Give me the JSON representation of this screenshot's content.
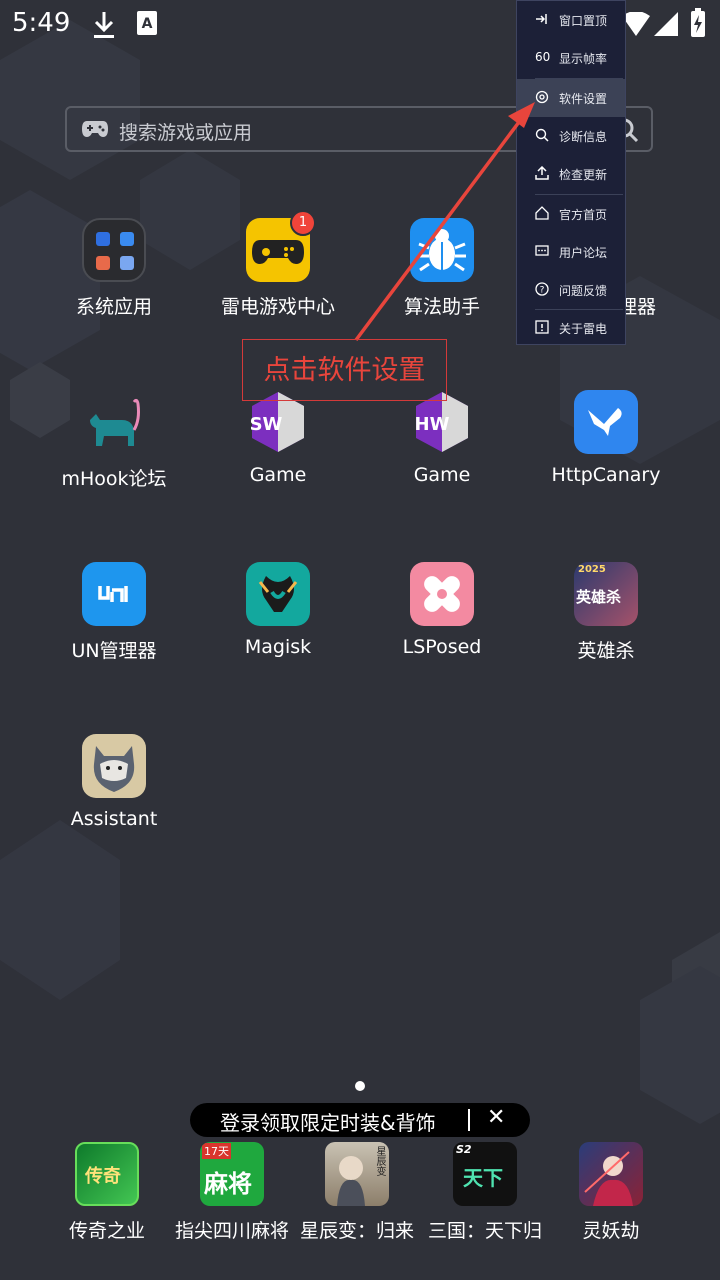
{
  "status_bar": {
    "time": "5:49"
  },
  "search": {
    "placeholder": "搜索游戏或应用"
  },
  "apps": [
    {
      "label": "系统应用"
    },
    {
      "label": "雷电游戏中心",
      "badge": "1"
    },
    {
      "label": "算法助手"
    },
    {
      "label": "理器"
    },
    {
      "label": "mHook论坛"
    },
    {
      "label": "Game",
      "icon_text": "SW"
    },
    {
      "label": "Game",
      "icon_text": "HW"
    },
    {
      "label": "HttpCanary"
    },
    {
      "label": "UN管理器"
    },
    {
      "label": "Magisk"
    },
    {
      "label": "LSPosed"
    },
    {
      "label": "英雄杀",
      "icon_text": "英雄杀",
      "icon_badge": "2025"
    },
    {
      "label": "Assistant"
    }
  ],
  "menu": {
    "items": [
      {
        "label": "窗口置顶",
        "icon": "pin-icon"
      },
      {
        "label": "显示帧率",
        "icon": "fps-icon",
        "icon_text": "60"
      },
      {
        "label": "软件设置",
        "icon": "settings-icon",
        "selected": true
      },
      {
        "label": "诊断信息",
        "icon": "diagnose-icon"
      },
      {
        "label": "检查更新",
        "icon": "update-icon"
      },
      {
        "label": "官方首页",
        "icon": "home-icon"
      },
      {
        "label": "用户论坛",
        "icon": "forum-icon"
      },
      {
        "label": "问题反馈",
        "icon": "feedback-icon"
      },
      {
        "label": "关于雷电",
        "icon": "about-icon"
      }
    ]
  },
  "annotation": {
    "text": "点击软件设置",
    "color": "#e8453c"
  },
  "promo": {
    "text": "登录领取限定时装&背饰",
    "close": "✕"
  },
  "dock": [
    {
      "label": "传奇之业",
      "icon_text": "传奇"
    },
    {
      "label": "指尖四川麻将",
      "icon_text": "麻将",
      "icon_badge": "17天"
    },
    {
      "label": "星辰变：归来",
      "icon_text": "星辰变"
    },
    {
      "label": "三国：天下归",
      "icon_text": "天下",
      "icon_badge": "S2"
    },
    {
      "label": "灵妖劫",
      "icon_text": ""
    }
  ]
}
